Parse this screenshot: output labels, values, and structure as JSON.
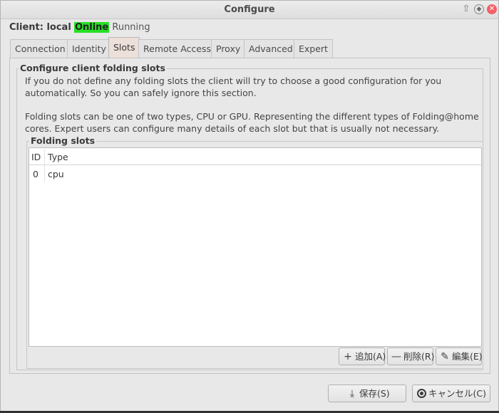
{
  "window": {
    "title": "Configure"
  },
  "client": {
    "label": "Client: local",
    "status": "Online",
    "state": "Running"
  },
  "tabs": [
    {
      "label": "Connection"
    },
    {
      "label": "Identity"
    },
    {
      "label": "Slots",
      "active": true
    },
    {
      "label": "Remote Access"
    },
    {
      "label": "Proxy"
    },
    {
      "label": "Advanced"
    },
    {
      "label": "Expert"
    }
  ],
  "section": {
    "title": "Configure client folding slots",
    "paragraph1": "If you do not define any folding slots the client will try to choose a good configuration for you automatically.  So you can safely ignore this section.",
    "paragraph2": "Folding slots can be one of two types, CPU or GPU.  Representing the different types of Folding@home cores. Expert users can configure many details of each slot but that is usually not necessary."
  },
  "slots": {
    "title": "Folding slots",
    "columns": [
      "ID",
      "Type"
    ],
    "rows": [
      {
        "id": "0",
        "type": "cpu"
      }
    ],
    "add_label": "追加(A)",
    "remove_label": "削除(R)",
    "edit_label": "編集(E)"
  },
  "footer": {
    "save_label": "保存(S)",
    "cancel_label": "キャンセル(C)"
  },
  "colors": {
    "online_badge": "#26e026",
    "active_tab": "#eddfd9",
    "close_button": "#f46067"
  }
}
